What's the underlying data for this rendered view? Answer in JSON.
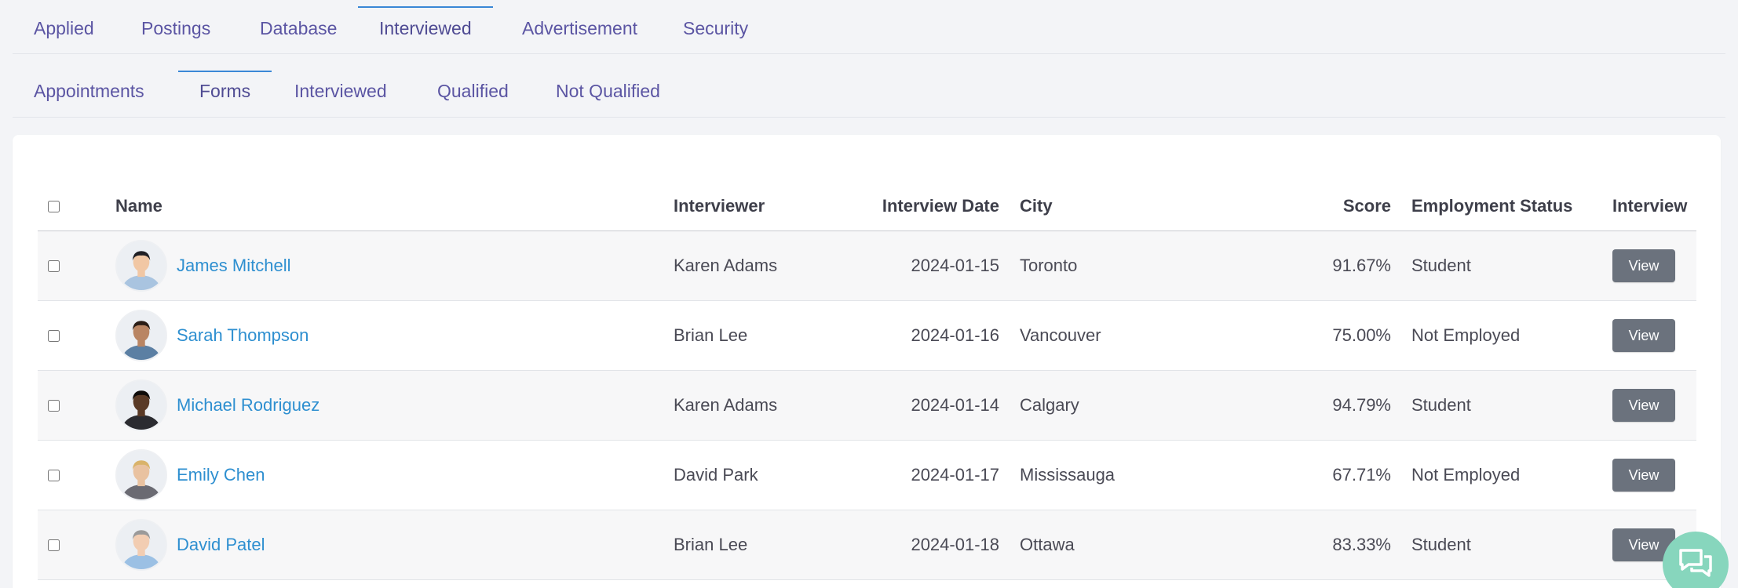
{
  "nav": {
    "primary_tabs": [
      {
        "label": "Applied",
        "active": false
      },
      {
        "label": "Postings",
        "active": false
      },
      {
        "label": "Database",
        "active": false
      },
      {
        "label": "Interviewed",
        "active": true
      },
      {
        "label": "Advertisement",
        "active": false
      },
      {
        "label": "Security",
        "active": false
      }
    ],
    "secondary_tabs": [
      {
        "label": "Appointments",
        "active": false
      },
      {
        "label": "Forms",
        "active": true
      },
      {
        "label": "Interviewed",
        "active": false
      },
      {
        "label": "Qualified",
        "active": false
      },
      {
        "label": "Not Qualified",
        "active": false
      }
    ]
  },
  "table": {
    "columns": [
      "Name",
      "Interviewer",
      "Interview Date",
      "City",
      "Score",
      "Employment Status",
      "Interview"
    ],
    "rows": [
      {
        "name": "James Mitchell",
        "interviewer": "Karen Adams",
        "date": "2024-01-15",
        "city": "Toronto",
        "score": "91.67%",
        "status": "Student",
        "action": "View",
        "avatar_icon": "person-avatar"
      },
      {
        "name": "Sarah Thompson",
        "interviewer": "Brian Lee",
        "date": "2024-01-16",
        "city": "Vancouver",
        "score": "75.00%",
        "status": "Not Employed",
        "action": "View",
        "avatar_icon": "person-avatar"
      },
      {
        "name": "Michael Rodriguez",
        "interviewer": "Karen Adams",
        "date": "2024-01-14",
        "city": "Calgary",
        "score": "94.79%",
        "status": "Student",
        "action": "View",
        "avatar_icon": "person-avatar"
      },
      {
        "name": "Emily Chen",
        "interviewer": "David Park",
        "date": "2024-01-17",
        "city": "Mississauga",
        "score": "67.71%",
        "status": "Not Employed",
        "action": "View",
        "avatar_icon": "person-avatar"
      },
      {
        "name": "David Patel",
        "interviewer": "Brian Lee",
        "date": "2024-01-18",
        "city": "Ottawa",
        "score": "83.33%",
        "status": "Student",
        "action": "View",
        "avatar_icon": "person-avatar"
      }
    ]
  },
  "chat": {
    "icon": "chat-bubbles-icon"
  },
  "colors": {
    "tab_text": "#5b55a3",
    "active_underline": "#3a87d6",
    "link": "#2e8fd0",
    "view_button": "#6b727d",
    "chat_bubble": "#87d6bd"
  }
}
